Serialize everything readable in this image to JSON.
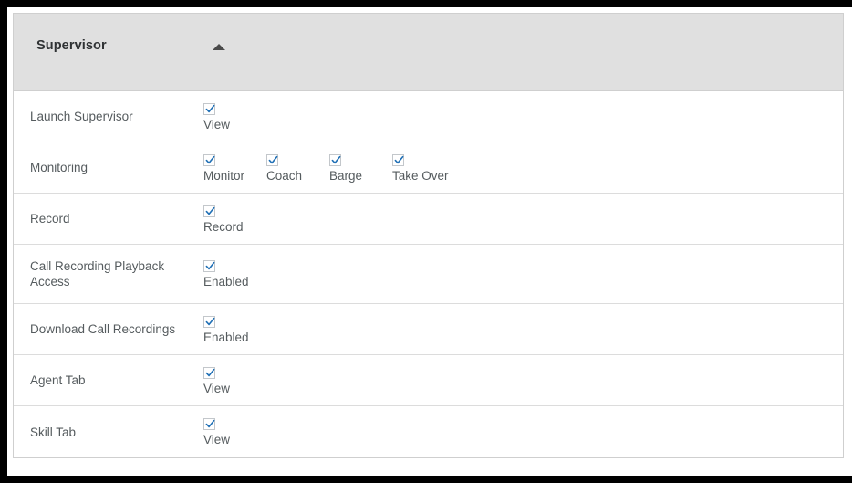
{
  "panel": {
    "title": "Supervisor",
    "collapse_icon": "caret-up-icon",
    "collapsed": false
  },
  "rows": [
    {
      "label": "Launch Supervisor",
      "controls": [
        {
          "label": "View",
          "checked": true
        }
      ]
    },
    {
      "label": "Monitoring",
      "controls": [
        {
          "label": "Monitor",
          "checked": true
        },
        {
          "label": "Coach",
          "checked": true
        },
        {
          "label": "Barge",
          "checked": true
        },
        {
          "label": "Take Over",
          "checked": true
        }
      ]
    },
    {
      "label": "Record",
      "controls": [
        {
          "label": "Record",
          "checked": true
        }
      ]
    },
    {
      "label": "Call Recording Playback Access",
      "controls": [
        {
          "label": "Enabled",
          "checked": true
        }
      ]
    },
    {
      "label": "Download Call Recordings",
      "controls": [
        {
          "label": "Enabled",
          "checked": true
        }
      ]
    },
    {
      "label": "Agent Tab",
      "controls": [
        {
          "label": "View",
          "checked": true
        }
      ]
    },
    {
      "label": "Skill Tab",
      "controls": [
        {
          "label": "View",
          "checked": true
        }
      ]
    }
  ],
  "colors": {
    "header_background": "#e0e0e0",
    "panel_border": "#cfcfcf",
    "row_divider": "#dcdcdc",
    "label_text": "#555b5e",
    "title_text": "#2f3234",
    "checkbox_border": "#c3c7cb",
    "check_mark": "#1f6fb5",
    "page_background": "#ffffff",
    "frame": "#000000"
  }
}
